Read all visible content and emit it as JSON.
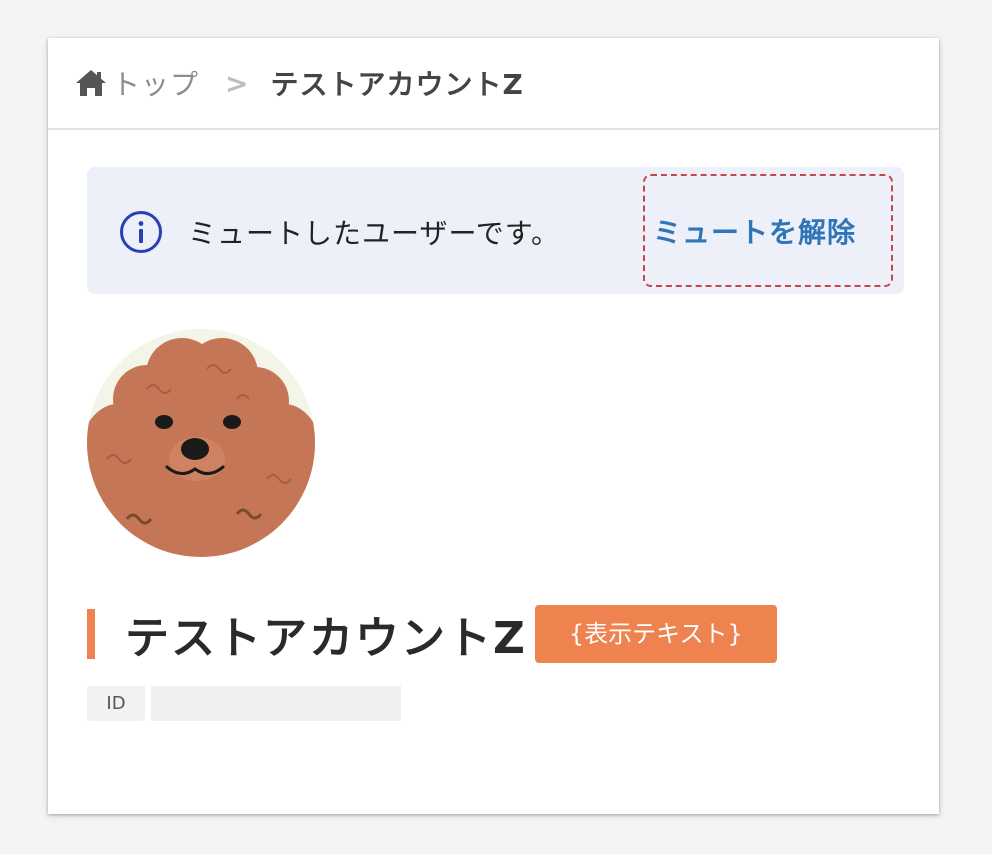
{
  "breadcrumb": {
    "home_icon": "home-icon",
    "home_label": "トップ",
    "separator": ">",
    "current": "テストアカウントZ"
  },
  "notice": {
    "icon": "info-icon",
    "message": "ミュートしたユーザーです。",
    "unmute_label": "ミュートを解除"
  },
  "profile": {
    "avatar": "poodle-avatar",
    "display_name": "テストアカウントZ",
    "tag_label": "{表示テキスト}",
    "id_label": "ID",
    "id_value": ""
  },
  "colors": {
    "accent_orange": "#ee8350",
    "link_blue": "#2f76b8",
    "info_blue": "#2b3fb5",
    "notice_bg": "#eef0f9",
    "highlight_red": "#c9454c"
  }
}
